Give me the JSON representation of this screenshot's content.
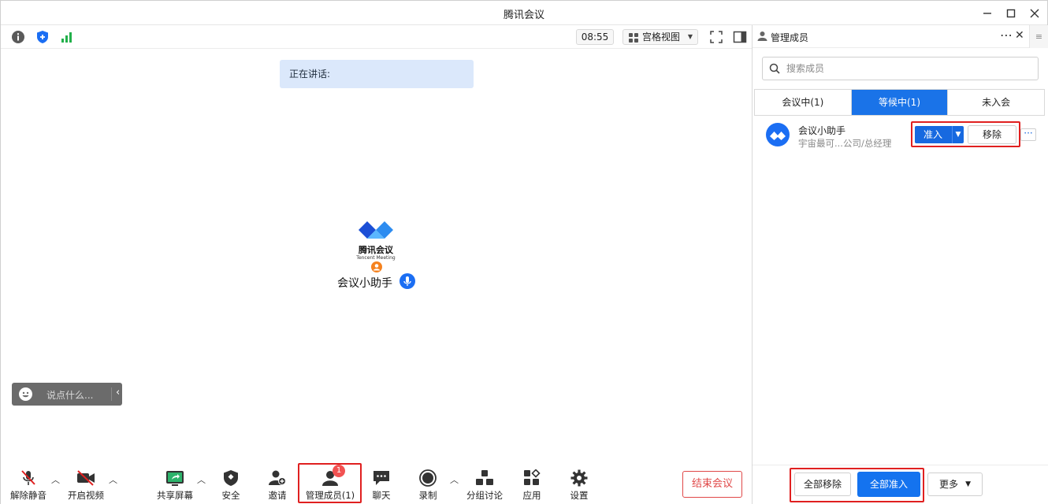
{
  "window": {
    "title": "腾讯会议"
  },
  "toolbar": {
    "time": "08:55",
    "view_label": "宫格视图"
  },
  "stage": {
    "speaking_label": "正在讲话:",
    "logo_text": "腾讯会议",
    "logo_subtext": "Tencent Meeting",
    "participant_name": "会议小助手",
    "chat_placeholder": "说点什么..."
  },
  "bottom": {
    "mute": "解除静音",
    "video": "开启视频",
    "share": "共享屏幕",
    "security": "安全",
    "invite": "邀请",
    "members": "管理成员(1)",
    "members_badge": "1",
    "chat": "聊天",
    "record": "录制",
    "breakout": "分组讨论",
    "apps": "应用",
    "settings": "设置",
    "end": "结束会议"
  },
  "panel": {
    "title": "管理成员",
    "search_placeholder": "搜索成员",
    "tabs": [
      {
        "label": "会议中(1)"
      },
      {
        "label": "等候中(1)"
      },
      {
        "label": "未入会"
      }
    ],
    "member": {
      "name": "会议小助手",
      "subtitle": "宇宙最可...公司/总经理",
      "admit": "准入",
      "remove": "移除"
    },
    "footer": {
      "remove_all": "全部移除",
      "admit_all": "全部准入",
      "more": "更多"
    }
  },
  "colors": {
    "accent": "#1769e0",
    "danger": "#e02020",
    "speaking_bg": "#dbe8fb"
  }
}
